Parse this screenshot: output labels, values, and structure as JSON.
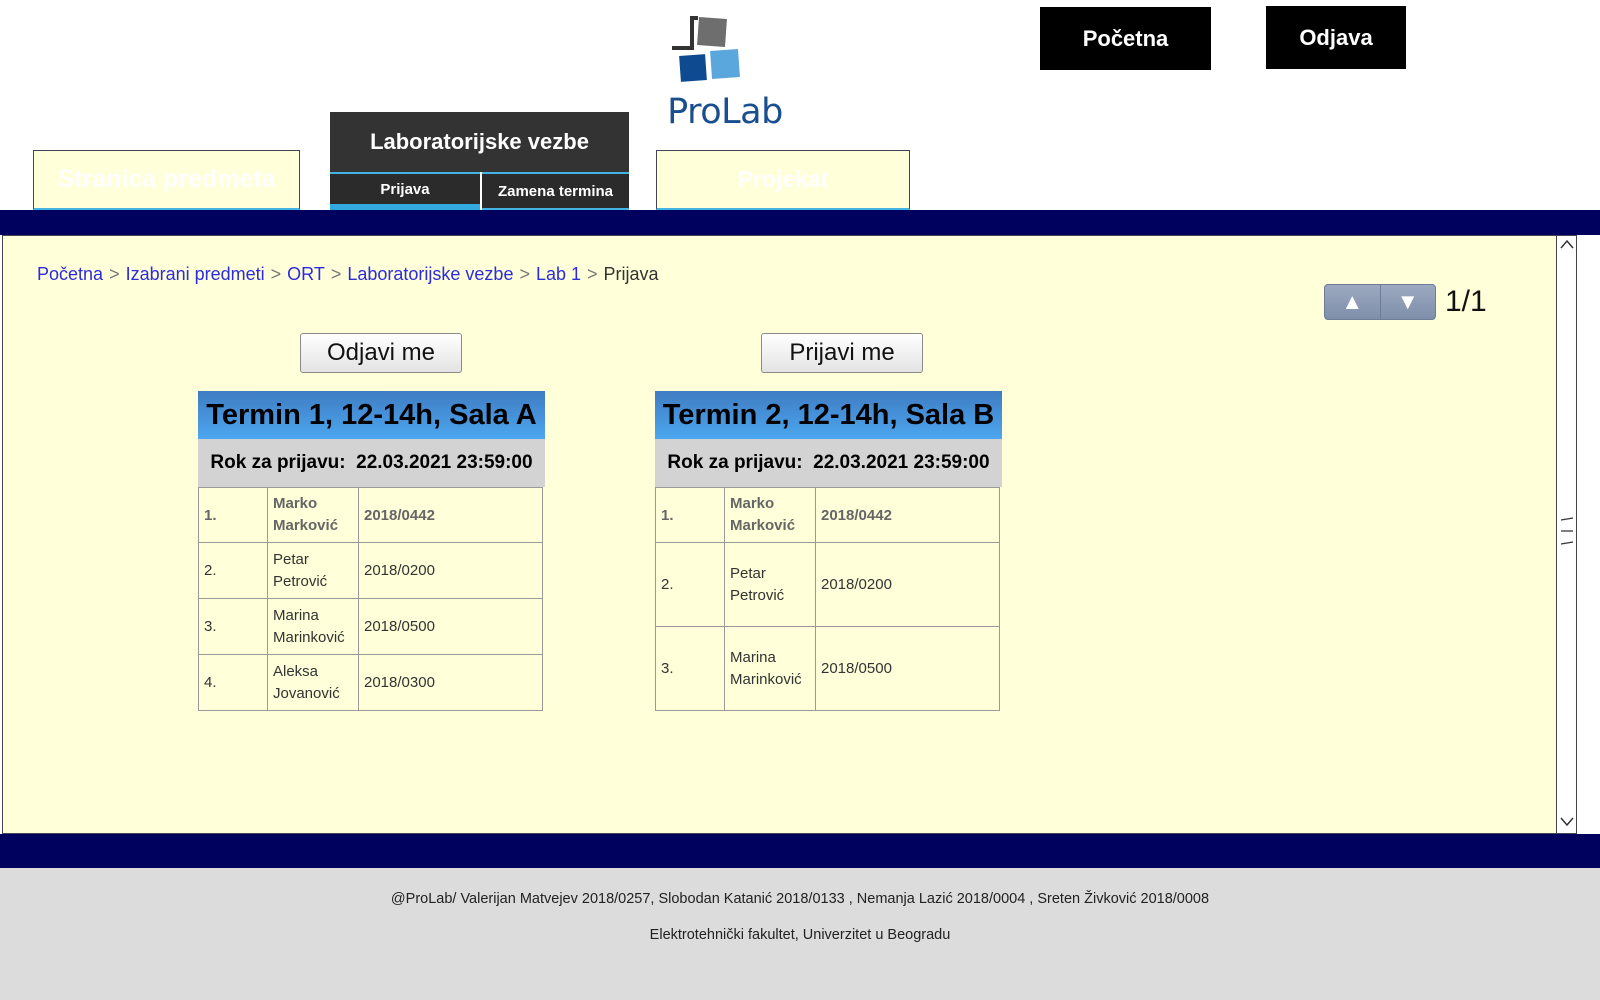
{
  "header": {
    "logo_text": "ProLab",
    "top_buttons": {
      "home": "Početna",
      "logout": "Odjava"
    },
    "tabs": {
      "course_page": "Stranica predmeta",
      "lab_exercises": "Laboratorijske vezbe",
      "lab_subtabs": {
        "register": "Prijava",
        "change_term": "Zamena termina"
      },
      "project": "Projekat"
    }
  },
  "breadcrumb": [
    "Početna",
    "Izabrani predmeti",
    "ORT",
    "Laboratorijske vezbe",
    "Lab 1",
    "Prijava"
  ],
  "breadcrumb_separator": ">",
  "pager": {
    "up_icon": "▲",
    "down_icon": "▼",
    "page": "1/1"
  },
  "terms": [
    {
      "action_label": "Odjavi me",
      "title": "Termin 1, 12-14h, Sala A",
      "deadline_label": "Rok za prijavu:",
      "deadline_value": "22.03.2021 23:59:00",
      "students": [
        {
          "num": "1.",
          "first": "Marko",
          "last": "Marković",
          "index": "2018/0442",
          "highlighted": true
        },
        {
          "num": "2.",
          "first": "Petar",
          "last": "Petrović",
          "index": "2018/0200"
        },
        {
          "num": "3.",
          "first": "Marina",
          "last": "Marinković",
          "index": "2018/0500"
        },
        {
          "num": "4.",
          "first": "Aleksa",
          "last": "Jovanović",
          "index": "2018/0300"
        }
      ]
    },
    {
      "action_label": "Prijavi me",
      "title": "Termin 2, 12-14h, Sala B",
      "deadline_label": "Rok za prijavu:",
      "deadline_value": "22.03.2021 23:59:00",
      "students": [
        {
          "num": "1.",
          "first": "Marko",
          "last": "Marković",
          "index": "2018/0442",
          "highlighted": true
        },
        {
          "num": "2.",
          "first": "Petar",
          "last": "Petrović",
          "index": "2018/0200"
        },
        {
          "num": "3.",
          "first": "Marina",
          "last": "Marinković",
          "index": "2018/0500"
        }
      ]
    }
  ],
  "footer": {
    "authors": "@ProLab/ Valerijan Matvejev 2018/0257, Slobodan Katanić 2018/0133 , Nemanja Lazić 2018/0004 , Sreten Živković 2018/0008",
    "institution": "Elektrotehnički fakultet, Univerzitet u Beogradu"
  },
  "colors": {
    "navy_band": "#00005e",
    "panel_bg": "#ffffd9",
    "tab_bg": "#333333",
    "tab_accent": "#43b4e4",
    "term_header": "#4a9ee8",
    "link": "#2b2be0"
  }
}
